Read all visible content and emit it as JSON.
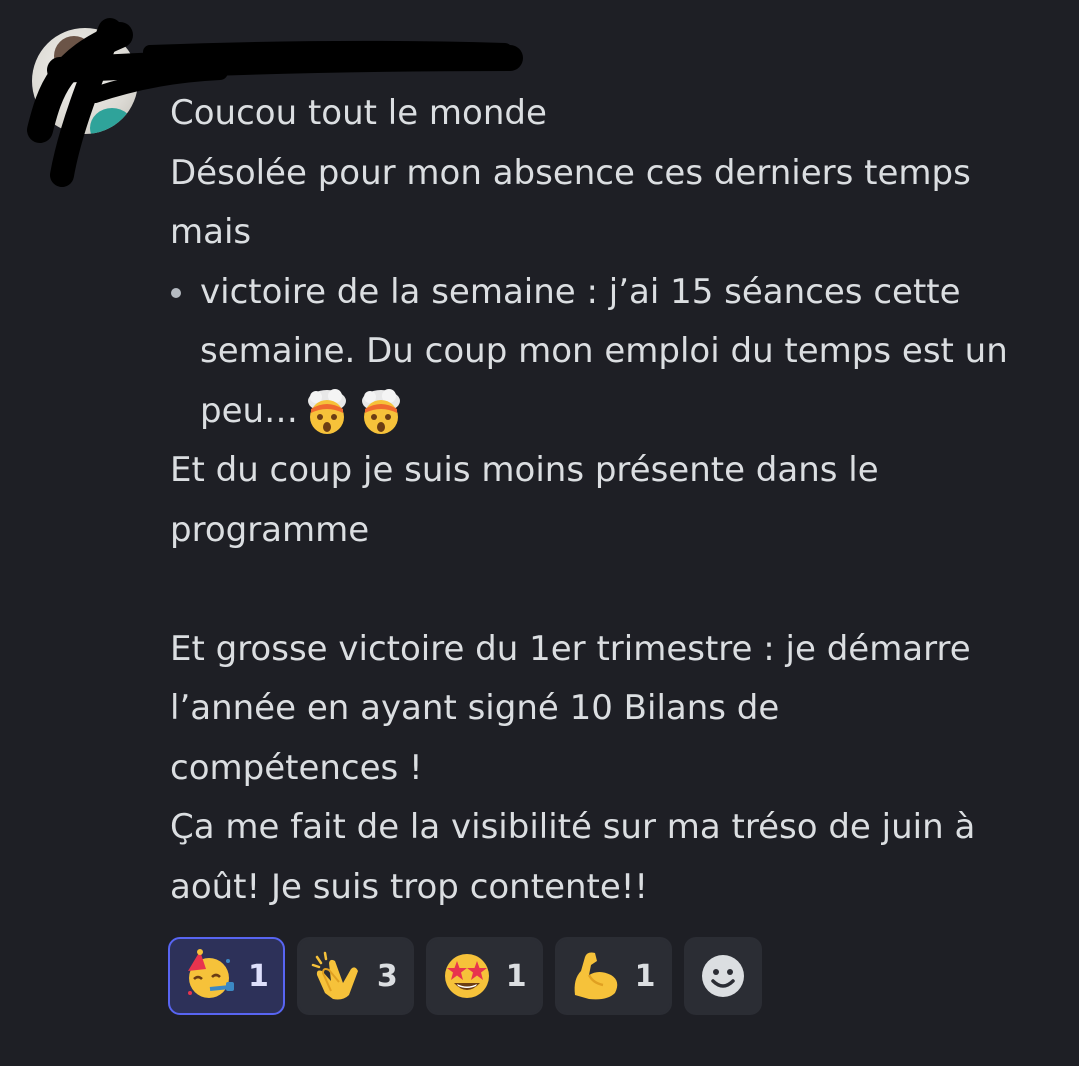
{
  "message": {
    "author": "",
    "lines": {
      "l1": "Coucou tout le monde",
      "l2": "Désolée pour mon absence ces derniers temps",
      "l3": "mais",
      "b1": "victoire de la semaine : j’ai 15 séances cette",
      "b2": "semaine. Du coup mon emploi du temps est un",
      "b3": "peu…",
      "l4": "Et du coup je suis moins présente dans le",
      "l5": "programme",
      "l6": "Et grosse victoire du 1er trimestre : je démarre",
      "l7": "l’année en ayant signé 10 Bilans de",
      "l8": "compétences !",
      "l9": "Ça me fait de la visibilité sur ma tréso de juin à",
      "l10": "août! Je suis trop contente!!"
    },
    "inline_emojis": [
      "exploding-head",
      "exploding-head"
    ]
  },
  "reactions": [
    {
      "emoji": "partying-face",
      "count": "1",
      "active": true
    },
    {
      "emoji": "clapping-hands",
      "count": "3",
      "active": false
    },
    {
      "emoji": "star-struck",
      "count": "1",
      "active": false
    },
    {
      "emoji": "flexed-biceps",
      "count": "1",
      "active": false
    }
  ],
  "add_reaction": {
    "icon": "smiley-add-reaction-icon"
  },
  "colors": {
    "background": "#1e1f25",
    "text": "#dbdee1",
    "reaction_bg": "#2b2d34",
    "reaction_active_bg": "#2d3159",
    "reaction_active_border": "#5865f2"
  }
}
